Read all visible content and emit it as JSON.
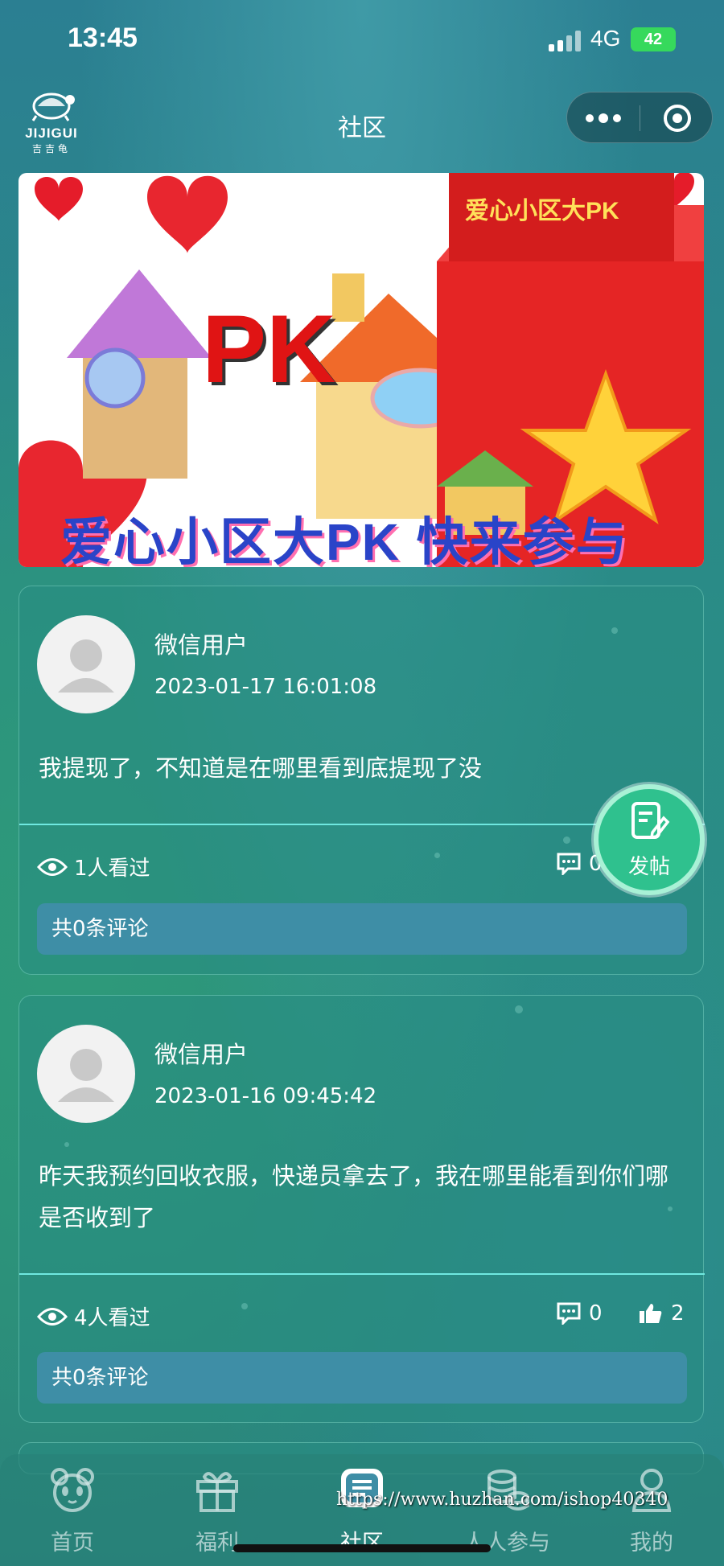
{
  "status_bar": {
    "time": "13:45",
    "network": "4G",
    "battery": "42"
  },
  "nav": {
    "logo_text": "JIJIGUI",
    "logo_sub": "吉吉龟",
    "title": "社区"
  },
  "banner": {
    "box_text": "爱心小区大PK",
    "pk_text": "PK",
    "slogan": "爱心小区大PK  快来参与"
  },
  "posts": [
    {
      "username": "微信用户",
      "time": "2023-01-17 16:01:08",
      "content": "我提现了，不知道是在哪里看到底提现了没",
      "views": "1人看过",
      "comments": "0",
      "likes": "",
      "comment_summary": "共0条评论"
    },
    {
      "username": "微信用户",
      "time": "2023-01-16 09:45:42",
      "content": "昨天我预约回收衣服，快递员拿去了，我在哪里能看到你们哪是否收到了",
      "views": "4人看过",
      "comments": "0",
      "likes": "2",
      "comment_summary": "共0条评论"
    }
  ],
  "fab": {
    "label": "发帖",
    "icon": "edit-icon"
  },
  "tabbar": {
    "tabs": [
      {
        "label": "首页",
        "icon": "panda-icon"
      },
      {
        "label": "福利",
        "icon": "gift-icon"
      },
      {
        "label": "社区",
        "icon": "chat-icon",
        "active": true
      },
      {
        "label": "人人参与",
        "icon": "coins-icon"
      },
      {
        "label": "我的",
        "icon": "user-icon"
      }
    ]
  },
  "watermark": "https://www.huzhan.com/ishop40340",
  "colors": {
    "accent": "#2fc18e",
    "comment_bar": "#3e8ea6",
    "divider": "#6fe8e0"
  }
}
